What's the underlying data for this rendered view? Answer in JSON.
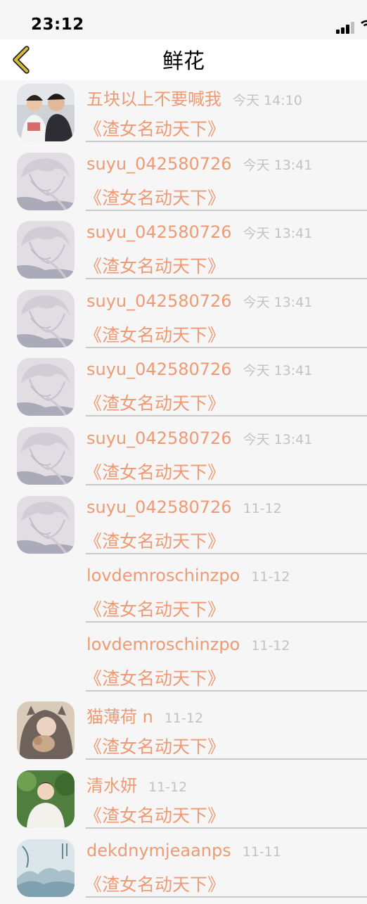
{
  "status_bar": {
    "time": "23:12"
  },
  "nav": {
    "title": "鲜花",
    "back_icon": "chevron-left-icon",
    "accent": "#d9b93a"
  },
  "colors": {
    "name": "#ee9a74",
    "time": "#c2c2c2"
  },
  "list": [
    {
      "name": "五块以上不要喊我",
      "time": "今天 14:10",
      "book": "《渣女名动天下》",
      "avatar": "photo-two-boys"
    },
    {
      "name": "suyu_042580726",
      "time": "今天 13:41",
      "book": "《渣女名动天下》",
      "avatar": "anime-sketch"
    },
    {
      "name": "suyu_042580726",
      "time": "今天 13:41",
      "book": "《渣女名动天下》",
      "avatar": "anime-sketch"
    },
    {
      "name": "suyu_042580726",
      "time": "今天 13:41",
      "book": "《渣女名动天下》",
      "avatar": "anime-sketch"
    },
    {
      "name": "suyu_042580726",
      "time": "今天 13:41",
      "book": "《渣女名动天下》",
      "avatar": "anime-sketch"
    },
    {
      "name": "suyu_042580726",
      "time": "今天 13:41",
      "book": "《渣女名动天下》",
      "avatar": "anime-sketch"
    },
    {
      "name": "suyu_042580726",
      "time": "11-12",
      "book": "《渣女名动天下》",
      "avatar": "anime-sketch"
    },
    {
      "name": "lovdemroschinzpo",
      "time": "11-12",
      "book": "《渣女名动天下》",
      "avatar": "none"
    },
    {
      "name": "lovdemroschinzpo",
      "time": "11-12",
      "book": "《渣女名动天下》",
      "avatar": "none"
    },
    {
      "name": "猫薄荷 n",
      "time": "11-12",
      "book": "《渣女名动天下》",
      "avatar": "photo-hood-kitten"
    },
    {
      "name": "清水妍",
      "time": "11-12",
      "book": "《渣女名动天下》",
      "avatar": "photo-boy-green"
    },
    {
      "name": "dekdnymjeaanps",
      "time": "11-11",
      "book": "《渣女名动天下》",
      "avatar": "ink-painting"
    }
  ]
}
